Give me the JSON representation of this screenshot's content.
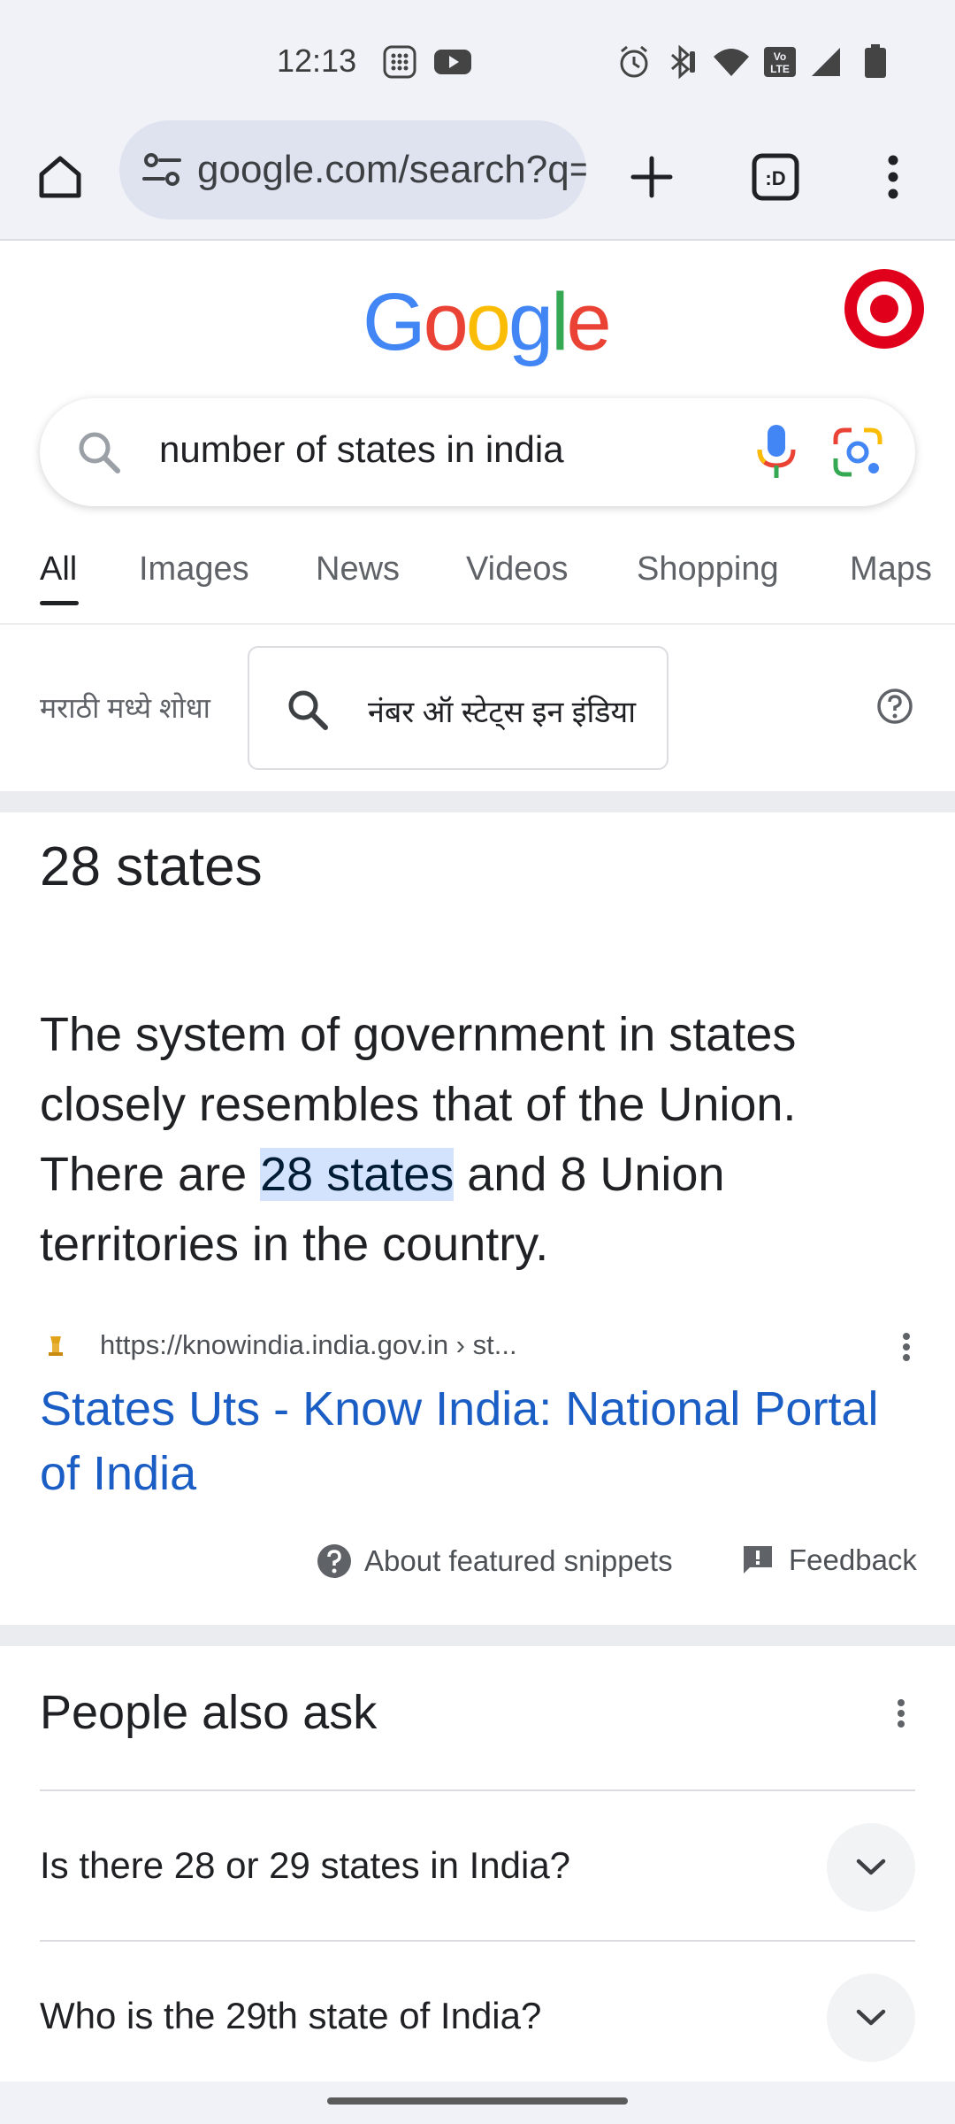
{
  "status_bar": {
    "time": "12:13",
    "icons": [
      "calculator-icon",
      "youtube-icon",
      "alarm-icon",
      "bluetooth-icon",
      "wifi-icon",
      "volte-icon",
      "signal-icon",
      "battery-icon"
    ]
  },
  "browser": {
    "url": "google.com/search?q=number+of+states+in+india",
    "icons": [
      "home-icon",
      "site-settings-icon",
      "new-tab-icon",
      "tab-switcher-icon",
      "more-icon"
    ]
  },
  "google": {
    "logo_letters": [
      "G",
      "o",
      "o",
      "g",
      "l",
      "e"
    ],
    "logo_colors": [
      "#4285f4",
      "#ea4335",
      "#fbbc05",
      "#4285f4",
      "#34a853",
      "#ea4335"
    ],
    "search_query": "number of states in india"
  },
  "tabs": [
    {
      "label": "All",
      "active": true
    },
    {
      "label": "Images"
    },
    {
      "label": "News"
    },
    {
      "label": "Videos"
    },
    {
      "label": "Shopping"
    },
    {
      "label": "Maps"
    }
  ],
  "translate": {
    "label": "मराठी मध्ये शोधा",
    "query": "नंबर ऑ स्टेट्स इन इंडिया"
  },
  "featured_snippet": {
    "answer": "28 states",
    "text_before": "The system of government in states closely resembles that of the Union. There are ",
    "highlight": "28 states",
    "text_after": " and 8 Union territories in the country.",
    "source_url": "https://knowindia.india.gov.in › st...",
    "result_title": "States Uts - Know India: National Portal of India",
    "about_label": "About featured snippets",
    "feedback_label": "Feedback"
  },
  "people_also_ask": {
    "title": "People also ask",
    "questions": [
      "Is there 28 or 29 states in India?",
      "Who is the 29th state of India?"
    ]
  },
  "colors": {
    "link": "#1a5dc4",
    "highlight_bg": "#d3e3fd",
    "chrome_bg": "#f1f2f8"
  }
}
